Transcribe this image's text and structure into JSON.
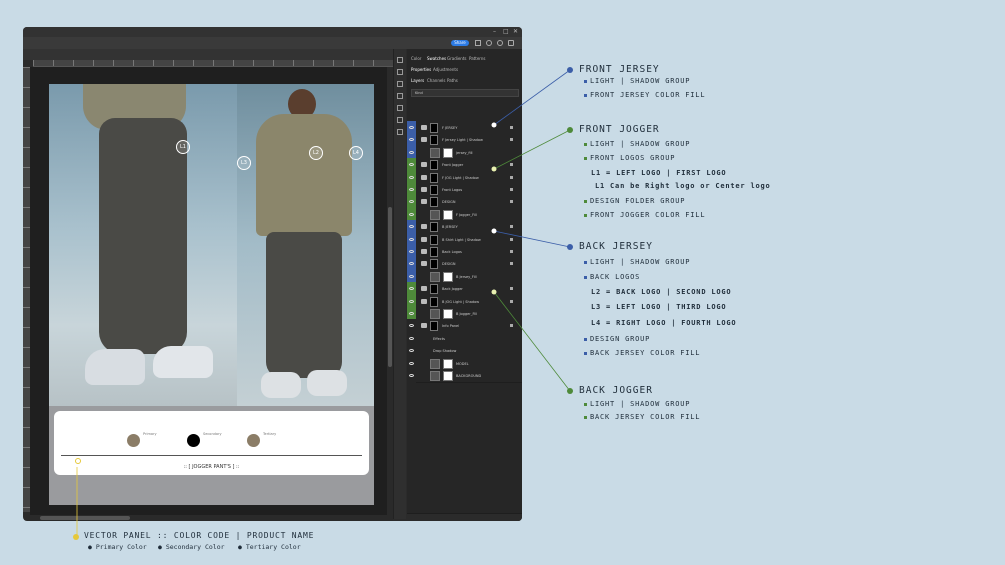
{
  "window": {
    "share_label": "Share",
    "panel_tabs_top": [
      "Color",
      "Swatches",
      "Gradients",
      "Patterns"
    ],
    "panel_tabs_mid": [
      "Properties",
      "Adjustments"
    ],
    "panel_tabs_layers": [
      "Layers",
      "Channels",
      "Paths"
    ],
    "filter_kind": "Kind"
  },
  "canvas": {
    "callouts": [
      "L1",
      "L2",
      "L3",
      "L4"
    ],
    "panel": {
      "swatches": [
        {
          "color": "#8b7d67",
          "label": "Primary"
        },
        {
          "color": "#000000",
          "label": "Secondary"
        },
        {
          "color": "#8b7d67",
          "label": "Tertiary"
        }
      ],
      "product_name": ":: [ JOGGER PANT'S ] ::"
    }
  },
  "layers": [
    {
      "name": "F JERSEY",
      "kind": "group",
      "color": "#3b5ea8"
    },
    {
      "name": "F Jersey Light | Shadow",
      "kind": "group",
      "color": "#3b5ea8"
    },
    {
      "name": "jersey_fill",
      "kind": "layer",
      "color": "#3b5ea8"
    },
    {
      "name": "Front Jogger",
      "kind": "group",
      "color": "#4e8a3a"
    },
    {
      "name": "F JOG Light | Shadow",
      "kind": "group",
      "color": "#4e8a3a"
    },
    {
      "name": "Front Logos",
      "kind": "group",
      "color": "#4e8a3a"
    },
    {
      "name": "DESIGN",
      "kind": "group",
      "color": "#4e8a3a"
    },
    {
      "name": "F Jogger_Fill",
      "kind": "layer",
      "color": "#4e8a3a"
    },
    {
      "name": "B JERSEY",
      "kind": "group",
      "color": "#3b5ea8"
    },
    {
      "name": "B Shirt Light | Shadow",
      "kind": "group",
      "color": "#3b5ea8"
    },
    {
      "name": "Back Logos",
      "kind": "group",
      "color": "#3b5ea8"
    },
    {
      "name": "DESIGN",
      "kind": "group",
      "color": "#3b5ea8"
    },
    {
      "name": "B Jersey_Fill",
      "kind": "layer",
      "color": "#3b5ea8"
    },
    {
      "name": "Back Jogger",
      "kind": "group",
      "color": "#4e8a3a"
    },
    {
      "name": "B JOG Light | Shadow",
      "kind": "group",
      "color": "#4e8a3a"
    },
    {
      "name": "B Jogger_Fill",
      "kind": "layer",
      "color": "#4e8a3a"
    },
    {
      "name": "Info Panel",
      "kind": "group",
      "color": "#262626"
    },
    {
      "name": "Effects",
      "kind": "fx",
      "color": "#262626"
    },
    {
      "name": "Drop Shadow",
      "kind": "fx",
      "color": "#262626"
    },
    {
      "name": "MODEL",
      "kind": "layer",
      "color": "#262626"
    },
    {
      "name": "BACKGROUND",
      "kind": "layer",
      "color": "#262626"
    }
  ],
  "annotations": {
    "front_jersey": {
      "title": "FRONT JERSEY",
      "items": [
        "LIGHT | SHADOW GROUP",
        "FRONT JERSEY COLOR FILL"
      ]
    },
    "front_jogger": {
      "title": "FRONT JOGGER",
      "items": [
        "LIGHT | SHADOW GROUP",
        "FRONT LOGOS GROUP",
        "L1 = LEFT LOGO | FIRST LOGO",
        "L1 Can be Right logo or Center logo",
        "DESIGN FOLDER GROUP",
        "FRONT JOGGER COLOR FILL"
      ]
    },
    "back_jersey": {
      "title": "BACK JERSEY",
      "items": [
        "LIGHT | SHADOW GROUP",
        "BACK LOGOS",
        "L2 = BACK LOGO | SECOND LOGO",
        "L3 = LEFT LOGO | THIRD LOGO",
        "L4 = RIGHT LOGO | FOURTH LOGO",
        "DESIGN GROUP",
        "BACK JERSEY COLOR FILL"
      ]
    },
    "back_jogger": {
      "title": "BACK JOGGER",
      "items": [
        "LIGHT | SHADOW GROUP",
        "BACK JERSEY COLOR FILL"
      ]
    },
    "vector_panel": {
      "title": "VECTOR PANEL :: COLOR CODE | PRODUCT NAME",
      "items": [
        "Primary Color",
        "Secondary Color",
        "Tertiary Color"
      ]
    }
  },
  "colors": {
    "jersey": "#3b5ea8",
    "jogger": "#4e8a3a",
    "vector": "#e6c83a"
  }
}
